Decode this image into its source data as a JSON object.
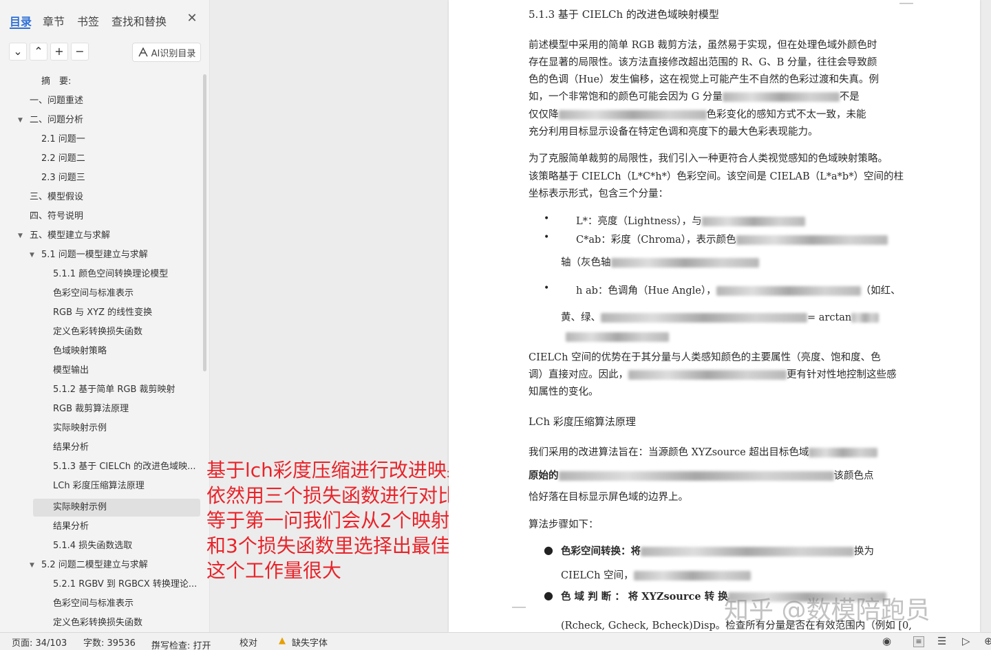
{
  "sidebar": {
    "tabs": [
      "目录",
      "章节",
      "书签",
      "查找和替换"
    ],
    "ai_button": "AI识别目录",
    "toc": [
      "摘　要:",
      "一、问题重述",
      "二、问题分析",
      "2.1 问题一",
      "2.2 问题二",
      "2.3 问题三",
      "三、模型假设",
      "四、符号说明",
      "五、模型建立与求解",
      "5.1 问题一模型建立与求解",
      "5.1.1  颜色空间转换理论模型",
      "色彩空间与标准表示",
      "RGB 与 XYZ 的线性变换",
      "定义色彩转换损失函数",
      "色域映射策略",
      "模型输出",
      "5.1.2  基于简单 RGB 裁剪映射",
      "RGB 裁剪算法原理",
      "实际映射示例",
      "结果分析",
      "5.1.3  基于 CIELCh 的改进色域映...",
      "LCh 彩度压缩算法原理",
      "实际映射示例",
      "结果分析",
      "5.1.4  损失函数选取",
      "5.2 问题二模型建立与求解",
      "5.2.1 RGBV 到 RGBCX 转换理论...",
      "色彩空间与标准表示",
      "定义色彩转换损失函数"
    ]
  },
  "annotation": [
    "基于lch彩度压缩进行改进映射",
    "依然用三个损失函数进行对比",
    "等于第一问我们会从2个映射",
    "和3个损失函数里选择出最佳的组合",
    "这个工作量很大"
  ],
  "doc": {
    "heading": "5.1.3  基于 CIELCh 的改进色域映射模型",
    "p1": [
      "前述模型中采用的简单 RGB 裁剪方法，虽然易于实现，但在处理色域外颜色时",
      "存在显著的局限性。该方法直接修改超出范围的 R、G、B 分量，往往会导致颜",
      "色的色调（Hue）发生偏移，这在视觉上可能产生不自然的色彩过渡和失真。例",
      "如，一个非常饱和的颜色可能会因为 G 分量",
      "仅仅降",
      "充分利用目标显示设备在特定色调和亮度下的最大色彩表现能力。"
    ],
    "p1_frag": [
      "不是",
      "色彩变化的感知方式不太一致，未能"
    ],
    "p2": [
      "为了克服简单裁剪的局限性，我们引入一种更符合人类视觉感知的色域映射策略。",
      "该策略基于 CIELCh（L*C*h*）色彩空间。该空间是 CIELAB（L*a*b*）空间的柱",
      "坐标表示形式，包含三个分量："
    ],
    "b1": "L*：亮度（Lightness），与",
    "b2": "C*ab：彩度（Chroma），表示颜色",
    "b2b": "轴（灰色轴",
    "b3": "h ab：色调角（Hue Angle），",
    "b3_tail": "（如红、",
    "b3b": "黄、绿、",
    "b3b_tail": "= arctan",
    "p3": [
      "CIELCh 空间的优势在于其分量与人类感知颜色的主要属性（亮度、饱和度、色",
      "调）直接对应。因此，",
      "知属性的变化。"
    ],
    "p3_tail": "更有针对性地控制这些感",
    "h2": "LCh 彩度压缩算法原理",
    "p4a": "我们采用的改进算法旨在：当源颜色 XYZsource 超出目标色域",
    "p4b": "原始的",
    "p4b_tail": "该颜色点",
    "p4c": "恰好落在目标显示屏色域的边界上。",
    "steps_label": "算法步骤如下：",
    "s1": "色彩空间转换：将",
    "s1_tail": "换为",
    "s1b": "CIELCh 空间，",
    "s2": "色 域 判 断 ：  将    XYZsource    转  换",
    "s3": "(Rcheck, Gcheck, Bcheck)Disp。检查所有分量是否在有效范围内（例如 [0,",
    "watermark": "知乎 @数模陪跑员"
  },
  "status": {
    "page": "页面: 34/103",
    "words": "字数: 39536",
    "spell": "拼写检查: 打开",
    "proof": "校对",
    "font_warn": "缺失字体"
  }
}
